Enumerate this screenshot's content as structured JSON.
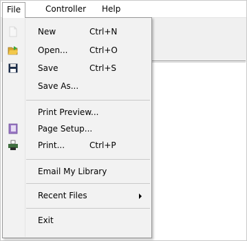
{
  "menubar": {
    "items": [
      {
        "label": "File"
      },
      {
        "label": "Controller"
      },
      {
        "label": "Help"
      }
    ]
  },
  "file_menu": {
    "items": [
      {
        "label": "New",
        "shortcut": "Ctrl+N",
        "icon": "new-document-icon"
      },
      {
        "label": "Open...",
        "shortcut": "Ctrl+O",
        "icon": "open-folder-icon"
      },
      {
        "label": "Save",
        "shortcut": "Ctrl+S",
        "icon": "save-disk-icon"
      },
      {
        "label": "Save As...",
        "shortcut": "",
        "icon": ""
      },
      {
        "label": "Print Preview...",
        "shortcut": "",
        "icon": ""
      },
      {
        "label": "Page Setup...",
        "shortcut": "",
        "icon": "page-setup-icon"
      },
      {
        "label": "Print...",
        "shortcut": "Ctrl+P",
        "icon": "printer-icon"
      },
      {
        "label": "Email My Library",
        "shortcut": "",
        "icon": ""
      },
      {
        "label": "Recent Files",
        "shortcut": "",
        "icon": "",
        "submenu": true
      },
      {
        "label": "Exit",
        "shortcut": "",
        "icon": ""
      }
    ]
  },
  "colors": {
    "menu_bg": "#f2f2f2",
    "menu_border": "#979797",
    "toolbar_bg": "#f0f0f0"
  }
}
